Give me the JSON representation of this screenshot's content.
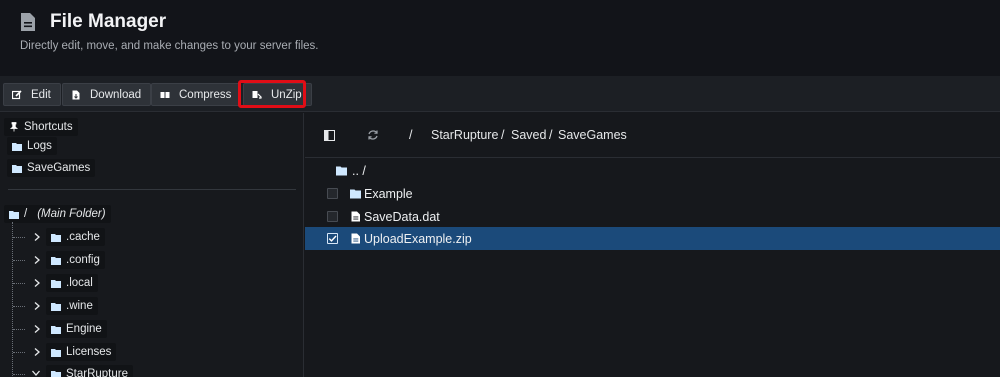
{
  "header": {
    "title": "File Manager",
    "subtitle": "Directly edit, move, and make changes to your server files."
  },
  "toolbar": {
    "edit": "Edit",
    "download": "Download",
    "compress": "Compress",
    "unzip": "UnZip",
    "highlight_color": "#e10d16"
  },
  "sidebar": {
    "shortcuts_label": "Shortcuts",
    "shortcuts": [
      "Logs",
      "SaveGames"
    ],
    "root": {
      "label": "/",
      "note": "(Main Folder)"
    },
    "tree": [
      ".cache",
      ".config",
      ".local",
      ".wine",
      "Engine",
      "Licenses",
      "StarRupture"
    ]
  },
  "path": {
    "root": "/",
    "segments": [
      "StarRupture",
      "Saved",
      "SaveGames"
    ],
    "separator": "/"
  },
  "files": {
    "parent": ".. /",
    "items": [
      {
        "name": "Example",
        "type": "folder",
        "checked": false
      },
      {
        "name": "SaveData.dat",
        "type": "file",
        "checked": false
      },
      {
        "name": "UploadExample.zip",
        "type": "file",
        "checked": true
      }
    ]
  },
  "colors": {
    "selected_row": "#1b4a7a",
    "folder": "#cfe8ff"
  }
}
